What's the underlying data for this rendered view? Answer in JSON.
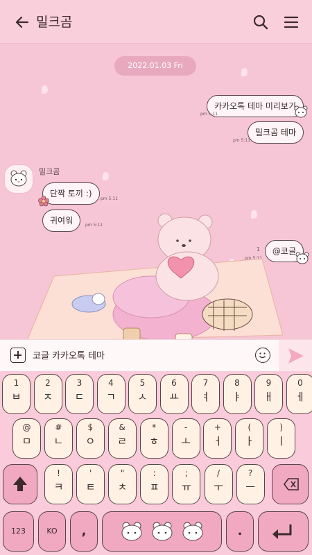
{
  "header": {
    "title": "밀크곰"
  },
  "chat": {
    "date": "2022.01.03 Fri",
    "messages_out": [
      {
        "text": "카카오톡 테마 미리보기",
        "time": "pm 5:11"
      },
      {
        "text": "밀크곰 테마",
        "time": "pm 5:11"
      },
      {
        "text": "@코글",
        "time": "pm 5:11",
        "read": "1"
      }
    ],
    "sender_name": "밀크곰",
    "messages_in": [
      {
        "text": "단짝 토끼 :)",
        "time": "pm 5:11"
      },
      {
        "text": "귀여워",
        "time": "pm 5:11"
      }
    ]
  },
  "input": {
    "text": "코글 카카오톡 테마"
  },
  "keyboard": {
    "row1": [
      {
        "sub": "1",
        "main": "ㅂ"
      },
      {
        "sub": "2",
        "main": "ㅈ"
      },
      {
        "sub": "3",
        "main": "ㄷ"
      },
      {
        "sub": "4",
        "main": "ㄱ"
      },
      {
        "sub": "5",
        "main": "ㅅ"
      },
      {
        "sub": "6",
        "main": "ㅛ"
      },
      {
        "sub": "7",
        "main": "ㅕ"
      },
      {
        "sub": "8",
        "main": "ㅑ"
      },
      {
        "sub": "9",
        "main": "ㅐ"
      },
      {
        "sub": "0",
        "main": "ㅔ"
      }
    ],
    "row2": [
      {
        "sub": "@",
        "main": "ㅁ"
      },
      {
        "sub": "#",
        "main": "ㄴ"
      },
      {
        "sub": "$",
        "main": "ㅇ"
      },
      {
        "sub": "&",
        "main": "ㄹ"
      },
      {
        "sub": "*",
        "main": "ㅎ"
      },
      {
        "sub": "-",
        "main": "ㅗ"
      },
      {
        "sub": "+",
        "main": "ㅓ"
      },
      {
        "sub": "(",
        "main": "ㅏ"
      },
      {
        "sub": ")",
        "main": "ㅣ"
      }
    ],
    "row3": [
      {
        "sub": "!",
        "main": "ㅋ"
      },
      {
        "sub": "'",
        "main": "ㅌ"
      },
      {
        "sub": "\"",
        "main": "ㅊ"
      },
      {
        "sub": ":",
        "main": "ㅍ"
      },
      {
        "sub": ";",
        "main": "ㅠ"
      },
      {
        "sub": "/",
        "main": "ㅜ"
      },
      {
        "sub": "?",
        "main": "ㅡ"
      }
    ],
    "sym_label": "123",
    "lang_label": "KO",
    "comma_label": ",",
    "period_label": "."
  },
  "colors": {
    "accent": "#f0a9c1",
    "bg": "#f7c6d6",
    "key": "#fff2e4",
    "outline": "#5a4448"
  }
}
